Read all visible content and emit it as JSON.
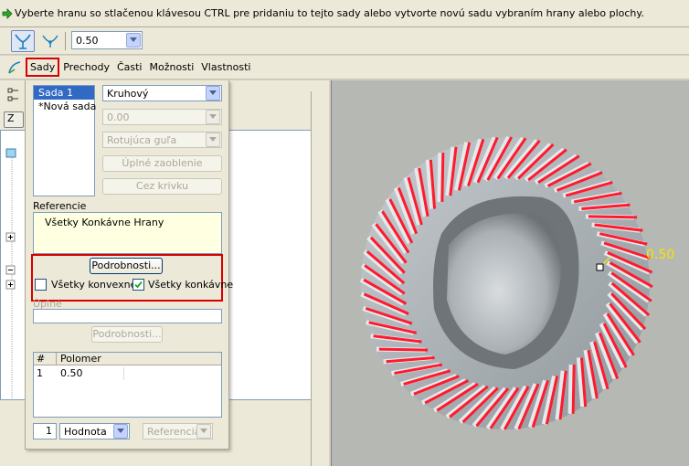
{
  "message": "Vyberte hranu so stlačenou klávesou CTRL pre pridaniu to tejto sady alebo vytvorte novú sadu vybraním hrany alebo plochy.",
  "toolbar": {
    "radius_value": "0.50",
    "icons": [
      "set-mode-icon",
      "transition-mode-icon"
    ]
  },
  "tabs": [
    "Sady",
    "Prechody",
    "Časti",
    "Možnosti",
    "Vlastnosti"
  ],
  "sets_panel": {
    "sets": [
      "Sada 1",
      "*Nová sada"
    ],
    "shape_type": "Kruhový",
    "value_disabled": "0.00",
    "method_disabled": "Rotujúca guľa",
    "full_round_button": "Úplné zaoblenie",
    "through_curve_button": "Cez krivku",
    "references_label": "Referencie",
    "references": [
      "Všetky Konkávne Hrany"
    ],
    "details_button": "Podrobnosti...",
    "all_convex_label": "Všetky konvexné",
    "all_convex_checked": false,
    "all_concave_label": "Všetky konkávne",
    "all_concave_checked": true,
    "full_label": "Úplné",
    "details_button_disabled": "Podrobnosti...",
    "radius_table": {
      "headers": [
        "#",
        "Polomer"
      ],
      "rows": [
        {
          "num": "1",
          "radius": "0.50"
        }
      ]
    },
    "spin_value": "1",
    "value_mode": "Hodnota",
    "reference_mode": "Referencia"
  },
  "left_tree": {
    "top_button": "Z"
  },
  "viewport": {
    "dimension_label": "0.50"
  },
  "colors": {
    "highlight_red": "#d80000",
    "edge_red": "#ff1a2e",
    "dim_yellow": "#f5e400"
  }
}
